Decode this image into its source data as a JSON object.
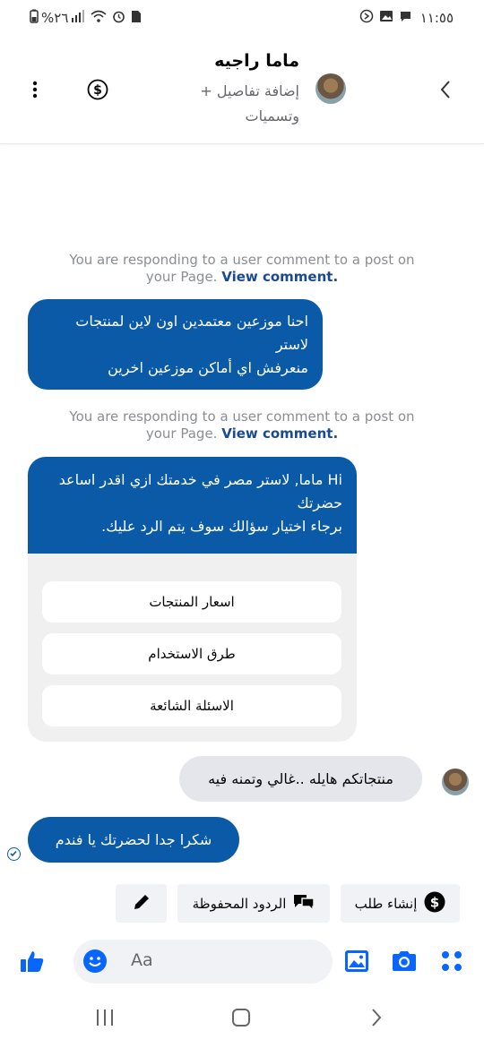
{
  "status_bar": {
    "time": "١١:٥٥",
    "battery": "%٢٦"
  },
  "header": {
    "contact_name": "ماما راجيه",
    "add_details": "+ إضافة تفاصيل وتسميات"
  },
  "messages": {
    "info_lines": [
      {
        "text": "You are responding to a user comment to a post on your Page.",
        "link": "View comment."
      },
      {
        "text": "You are responding to a user comment to a post on your Page.",
        "link": "View comment."
      }
    ],
    "bubble1": [
      "احنا موزعين معتمدين اون لاين لمنتجات لاستر",
      "منعرفش اي أماكن موزعين اخرين"
    ],
    "card": {
      "text": [
        "Hi ماما, لاستر مصر في خدمتك ازي اقدر اساعد حضرتك",
        "برجاء اختيار سؤالك سوف يتم الرد عليك."
      ],
      "buttons": [
        "اسعار المنتجات",
        "طرق الاستخدام",
        "الاسئلة الشائعة"
      ]
    },
    "incoming": "منتجاتكم هايله ..غالي وتمنه فيه",
    "outgoing": "شكرا جدا  لحضرتك يا فندم"
  },
  "actions": {
    "create_order": "إنشاء طلب",
    "saved_replies": "الردود المحفوظة"
  },
  "composer": {
    "placeholder": "Aa"
  },
  "colors": {
    "accent": "#0a5aa8",
    "link": "#1a4a8f"
  }
}
